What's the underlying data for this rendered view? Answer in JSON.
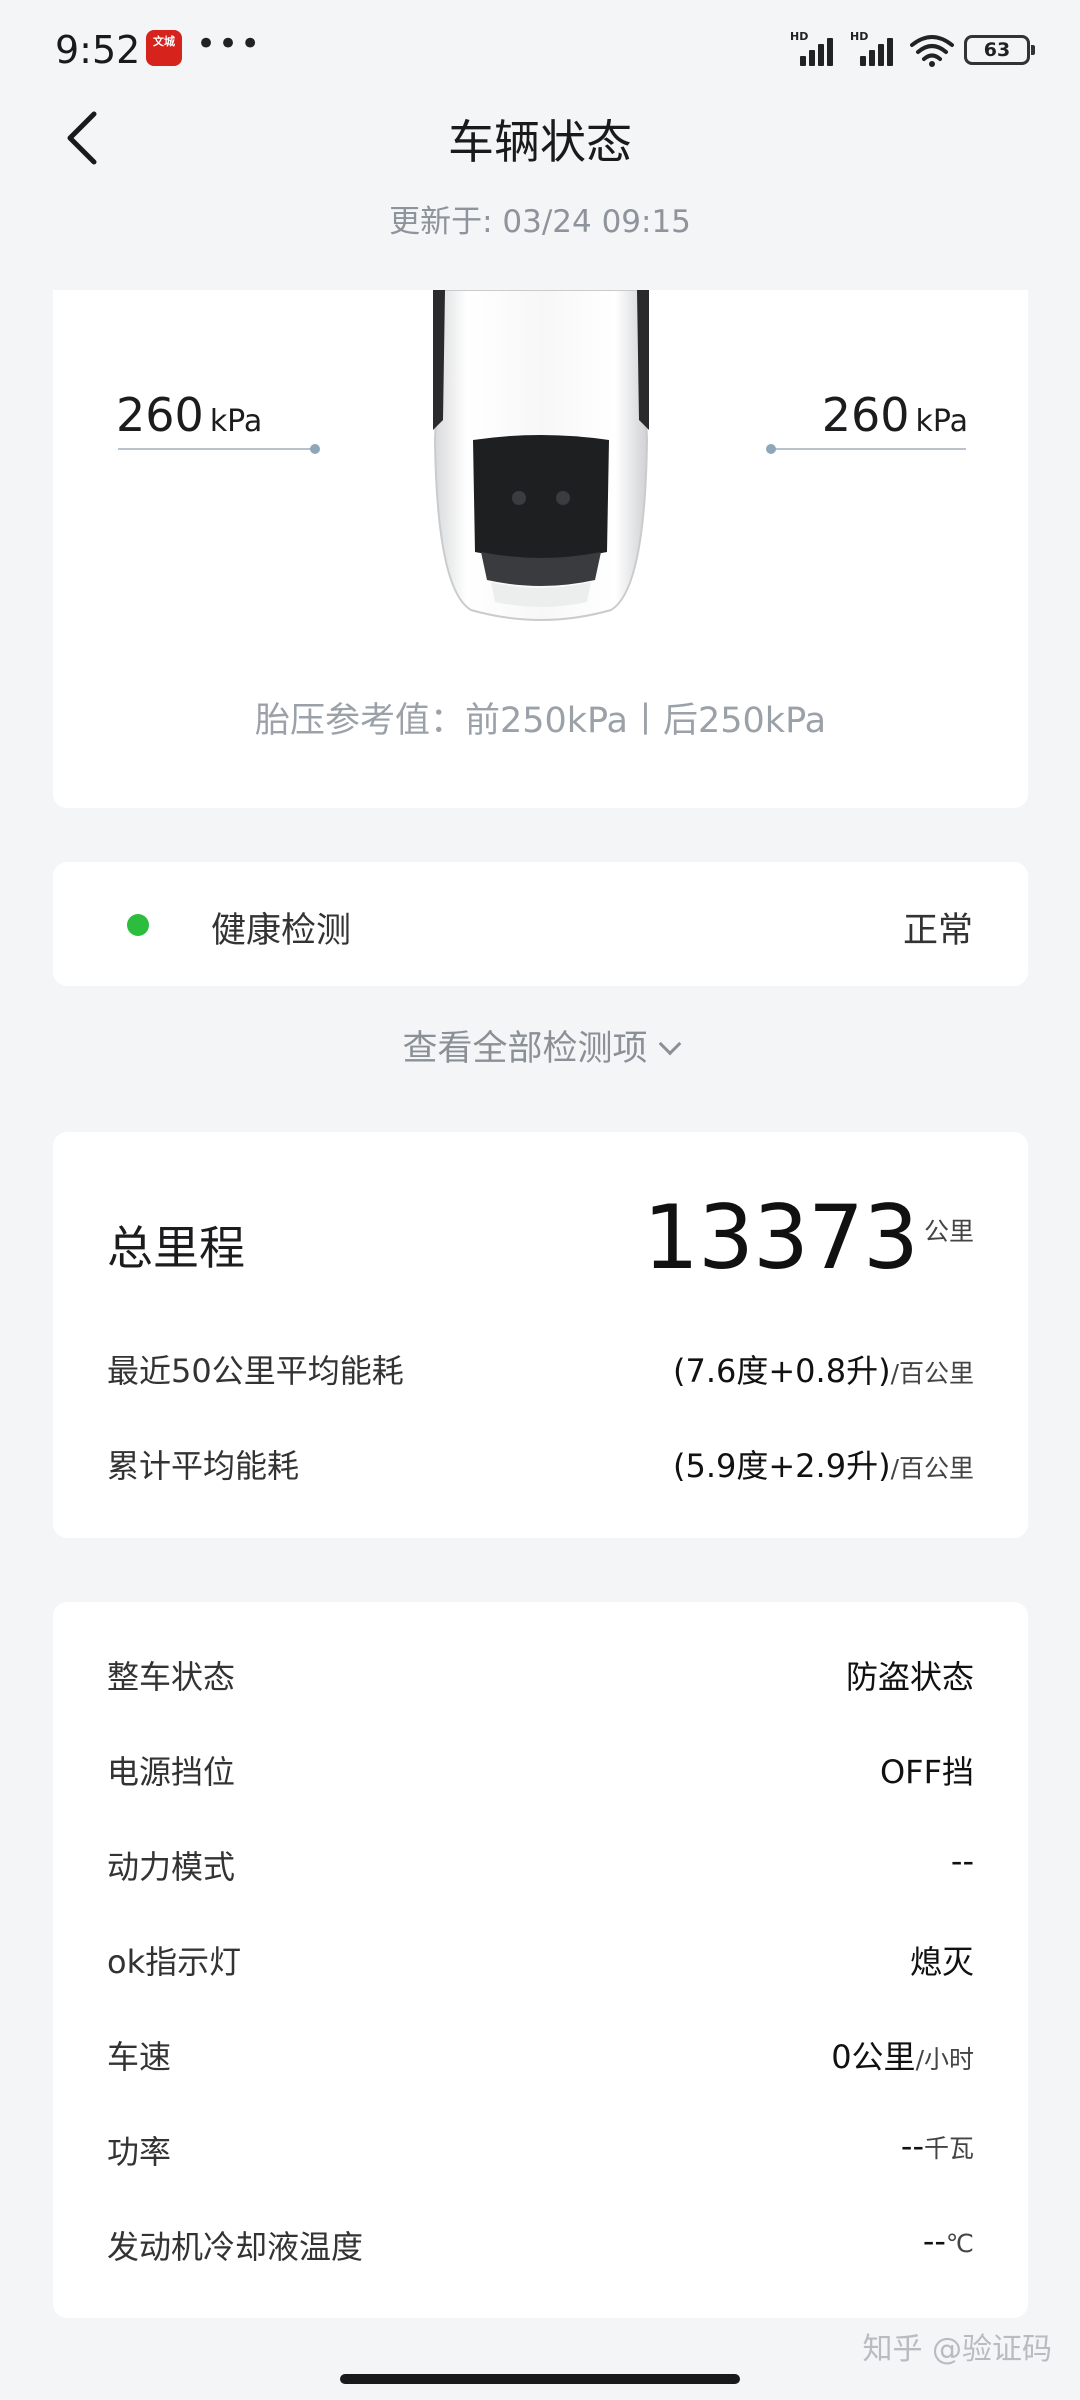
{
  "status_bar": {
    "time": "9:52",
    "app_icon_text": "文城",
    "dots": "•••",
    "hd1": "HD",
    "hd2": "HD",
    "battery": "63"
  },
  "header": {
    "title": "车辆状态",
    "updated": "更新于: 03/24 09:15"
  },
  "tire": {
    "left_value": "260",
    "left_unit": "kPa",
    "right_value": "260",
    "right_unit": "kPa",
    "reference": "胎压参考值：前250kPa丨后250kPa"
  },
  "health": {
    "label": "健康检测",
    "status": "正常",
    "status_color": "#2cbd3e",
    "view_all": "查看全部检测项"
  },
  "mileage": {
    "label": "总里程",
    "value": "13373",
    "unit": "公里",
    "rows": [
      {
        "label": "最近50公里平均能耗",
        "value": "(7.6度+0.8升)",
        "unit": "/百公里"
      },
      {
        "label": "累计平均能耗",
        "value": "(5.9度+2.9升)",
        "unit": "/百公里"
      }
    ]
  },
  "vehicle_status": [
    {
      "label": "整车状态",
      "value": "防盗状态",
      "unit": ""
    },
    {
      "label": "电源挡位",
      "value": "OFF挡",
      "unit": ""
    },
    {
      "label": "动力模式",
      "value": "--",
      "unit": ""
    },
    {
      "label": "ok指示灯",
      "value": "熄灭",
      "unit": ""
    },
    {
      "label": "车速",
      "value": "0公里",
      "unit": "/小时"
    },
    {
      "label": "功率",
      "value": "--",
      "unit": "千瓦"
    },
    {
      "label": "发动机冷却液温度",
      "value": "--",
      "unit": "℃"
    }
  ],
  "watermark": "知乎 @验证码"
}
